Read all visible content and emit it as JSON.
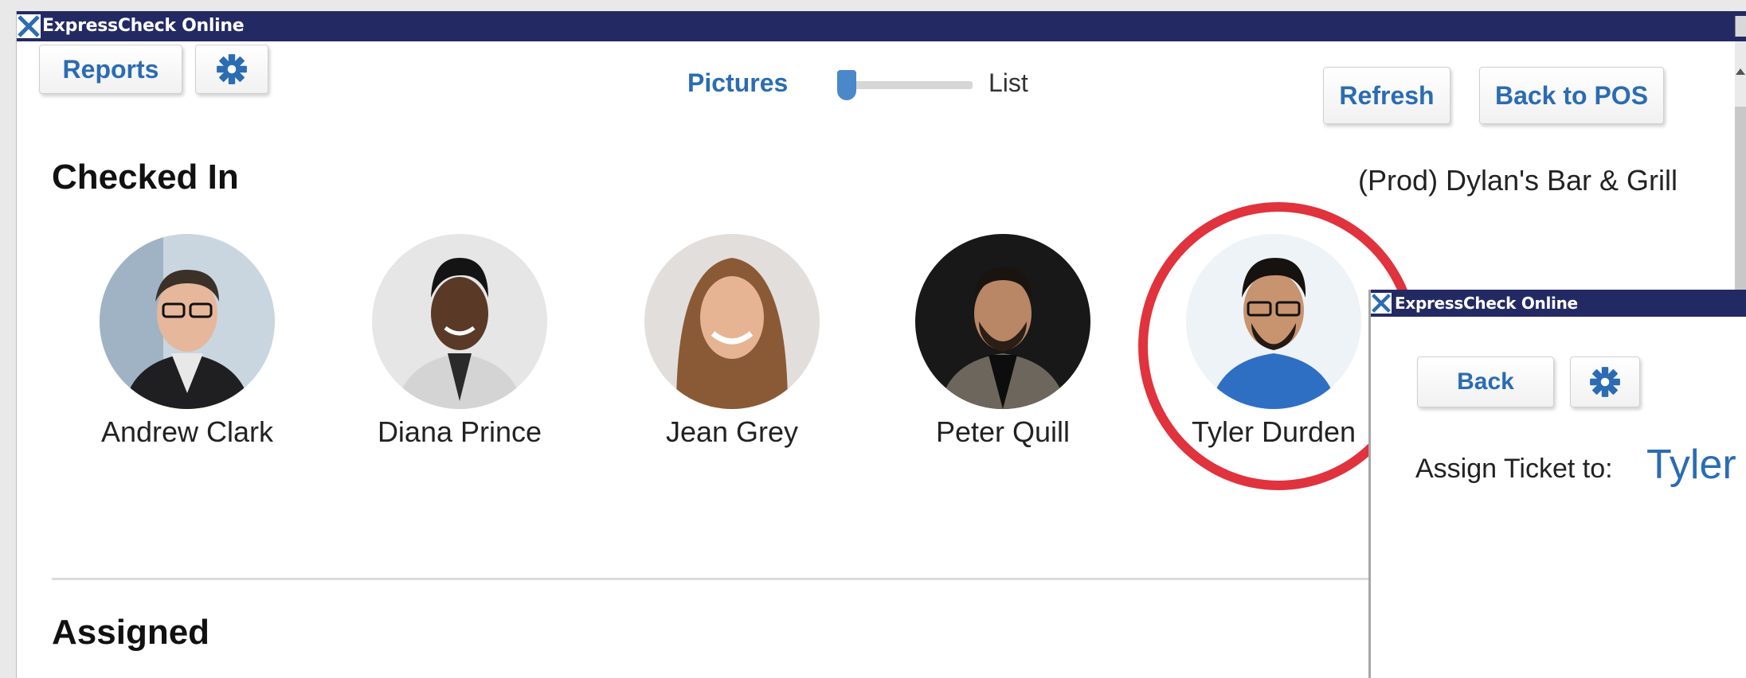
{
  "main_window": {
    "title": "ExpressCheck Online",
    "toolbar": {
      "reports_label": "Reports",
      "view_toggle": {
        "left_label": "Pictures",
        "right_label": "List",
        "selected": "Pictures"
      },
      "refresh_label": "Refresh",
      "back_to_pos_label": "Back to POS"
    },
    "checked_in": {
      "heading": "Checked In",
      "location": "(Prod) Dylan's Bar & Grill",
      "people": [
        {
          "name": "Andrew Clark"
        },
        {
          "name": "Diana Prince"
        },
        {
          "name": "Jean Grey"
        },
        {
          "name": "Peter Quill"
        },
        {
          "name": "Tyler Durden"
        }
      ]
    },
    "assigned": {
      "heading": "Assigned"
    }
  },
  "popup": {
    "title": "ExpressCheck Online",
    "back_label": "Back",
    "assign_label": "Assign Ticket to:",
    "assign_name": "Tyler"
  },
  "colors": {
    "titlebar": "#232a63",
    "accent": "#2b6cb3",
    "highlight": "#e0333d"
  },
  "icons": {
    "settings": "gear-icon",
    "app": "x-logo-icon"
  }
}
